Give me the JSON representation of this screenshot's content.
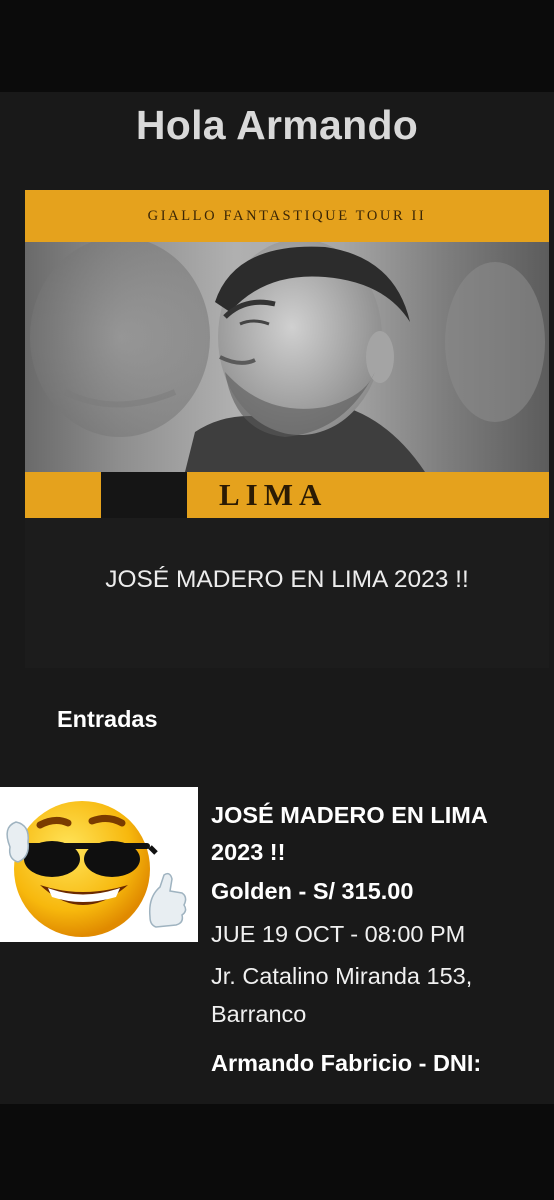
{
  "greeting": "Hola Armando",
  "event": {
    "poster": {
      "tour_name": "GIALLO FANTASTIQUE TOUR II",
      "city": "LIMA"
    },
    "title": "JOSÉ MADERO EN LIMA 2023 !!"
  },
  "tickets_section": {
    "title": "Entradas",
    "ticket": {
      "icon": "sunglasses-smiley-thumbs-up",
      "event_name": "JOSÉ MADERO EN LIMA 2023 !!",
      "zone_price": "Golden - S/ 315.00",
      "datetime": "JUE 19 OCT - 08:00 PM",
      "address": "Jr. Catalino Miranda 153, Barranco",
      "holder": "Armando Fabricio - DNI:"
    }
  },
  "colors": {
    "background": "#191919",
    "poster_accent": "#e5a21d",
    "text": "#ffffff"
  }
}
